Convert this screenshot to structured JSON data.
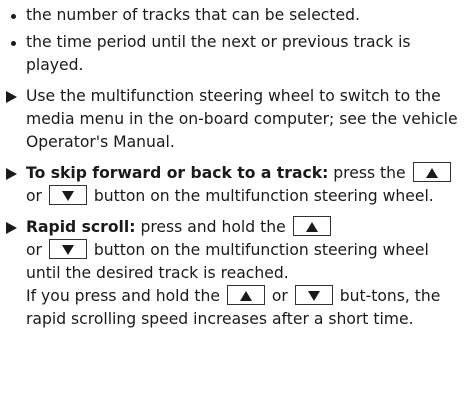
{
  "bullets": [
    "the number of tracks that can be selected.",
    "the time period until the next or previous track is played."
  ],
  "step1": {
    "text": "Use the multifunction steering wheel to switch to the media menu in the on-board computer; see the vehicle Operator's Manual."
  },
  "step2": {
    "bold": "To skip forward or back to a track:",
    "t1": " press the ",
    "t2": " or ",
    "t3": " button on the multifunction steering wheel."
  },
  "step3": {
    "bold": "Rapid scroll:",
    "t1": " press and hold the ",
    "t2": " or ",
    "t3": " button on the multifunction steering wheel until the desired track is reached.",
    "t4": "If you press and hold the ",
    "t5": " or ",
    "t6": " but-tons, the rapid scrolling speed increases after a short time."
  },
  "icons": {
    "up": "up-arrow-button-icon",
    "down": "down-arrow-button-icon"
  }
}
